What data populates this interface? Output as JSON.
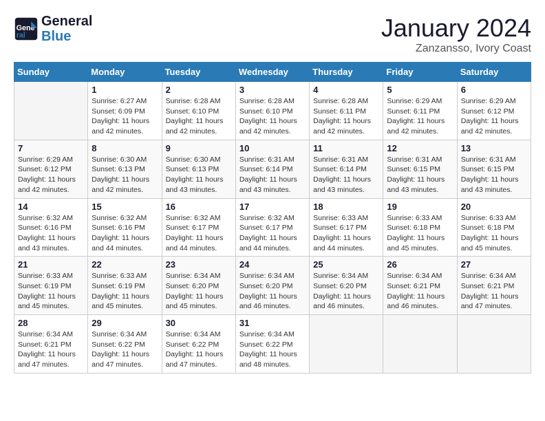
{
  "logo": {
    "line1": "General",
    "line2": "Blue"
  },
  "title": "January 2024",
  "subtitle": "Zanzansso, Ivory Coast",
  "days_header": [
    "Sunday",
    "Monday",
    "Tuesday",
    "Wednesday",
    "Thursday",
    "Friday",
    "Saturday"
  ],
  "weeks": [
    [
      {
        "day": "",
        "sunrise": "",
        "sunset": "",
        "daylight": ""
      },
      {
        "day": "1",
        "sunrise": "Sunrise: 6:27 AM",
        "sunset": "Sunset: 6:09 PM",
        "daylight": "Daylight: 11 hours and 42 minutes."
      },
      {
        "day": "2",
        "sunrise": "Sunrise: 6:28 AM",
        "sunset": "Sunset: 6:10 PM",
        "daylight": "Daylight: 11 hours and 42 minutes."
      },
      {
        "day": "3",
        "sunrise": "Sunrise: 6:28 AM",
        "sunset": "Sunset: 6:10 PM",
        "daylight": "Daylight: 11 hours and 42 minutes."
      },
      {
        "day": "4",
        "sunrise": "Sunrise: 6:28 AM",
        "sunset": "Sunset: 6:11 PM",
        "daylight": "Daylight: 11 hours and 42 minutes."
      },
      {
        "day": "5",
        "sunrise": "Sunrise: 6:29 AM",
        "sunset": "Sunset: 6:11 PM",
        "daylight": "Daylight: 11 hours and 42 minutes."
      },
      {
        "day": "6",
        "sunrise": "Sunrise: 6:29 AM",
        "sunset": "Sunset: 6:12 PM",
        "daylight": "Daylight: 11 hours and 42 minutes."
      }
    ],
    [
      {
        "day": "7",
        "sunrise": "Sunrise: 6:29 AM",
        "sunset": "Sunset: 6:12 PM",
        "daylight": "Daylight: 11 hours and 42 minutes."
      },
      {
        "day": "8",
        "sunrise": "Sunrise: 6:30 AM",
        "sunset": "Sunset: 6:13 PM",
        "daylight": "Daylight: 11 hours and 42 minutes."
      },
      {
        "day": "9",
        "sunrise": "Sunrise: 6:30 AM",
        "sunset": "Sunset: 6:13 PM",
        "daylight": "Daylight: 11 hours and 43 minutes."
      },
      {
        "day": "10",
        "sunrise": "Sunrise: 6:31 AM",
        "sunset": "Sunset: 6:14 PM",
        "daylight": "Daylight: 11 hours and 43 minutes."
      },
      {
        "day": "11",
        "sunrise": "Sunrise: 6:31 AM",
        "sunset": "Sunset: 6:14 PM",
        "daylight": "Daylight: 11 hours and 43 minutes."
      },
      {
        "day": "12",
        "sunrise": "Sunrise: 6:31 AM",
        "sunset": "Sunset: 6:15 PM",
        "daylight": "Daylight: 11 hours and 43 minutes."
      },
      {
        "day": "13",
        "sunrise": "Sunrise: 6:31 AM",
        "sunset": "Sunset: 6:15 PM",
        "daylight": "Daylight: 11 hours and 43 minutes."
      }
    ],
    [
      {
        "day": "14",
        "sunrise": "Sunrise: 6:32 AM",
        "sunset": "Sunset: 6:16 PM",
        "daylight": "Daylight: 11 hours and 43 minutes."
      },
      {
        "day": "15",
        "sunrise": "Sunrise: 6:32 AM",
        "sunset": "Sunset: 6:16 PM",
        "daylight": "Daylight: 11 hours and 44 minutes."
      },
      {
        "day": "16",
        "sunrise": "Sunrise: 6:32 AM",
        "sunset": "Sunset: 6:17 PM",
        "daylight": "Daylight: 11 hours and 44 minutes."
      },
      {
        "day": "17",
        "sunrise": "Sunrise: 6:32 AM",
        "sunset": "Sunset: 6:17 PM",
        "daylight": "Daylight: 11 hours and 44 minutes."
      },
      {
        "day": "18",
        "sunrise": "Sunrise: 6:33 AM",
        "sunset": "Sunset: 6:17 PM",
        "daylight": "Daylight: 11 hours and 44 minutes."
      },
      {
        "day": "19",
        "sunrise": "Sunrise: 6:33 AM",
        "sunset": "Sunset: 6:18 PM",
        "daylight": "Daylight: 11 hours and 45 minutes."
      },
      {
        "day": "20",
        "sunrise": "Sunrise: 6:33 AM",
        "sunset": "Sunset: 6:18 PM",
        "daylight": "Daylight: 11 hours and 45 minutes."
      }
    ],
    [
      {
        "day": "21",
        "sunrise": "Sunrise: 6:33 AM",
        "sunset": "Sunset: 6:19 PM",
        "daylight": "Daylight: 11 hours and 45 minutes."
      },
      {
        "day": "22",
        "sunrise": "Sunrise: 6:33 AM",
        "sunset": "Sunset: 6:19 PM",
        "daylight": "Daylight: 11 hours and 45 minutes."
      },
      {
        "day": "23",
        "sunrise": "Sunrise: 6:34 AM",
        "sunset": "Sunset: 6:20 PM",
        "daylight": "Daylight: 11 hours and 45 minutes."
      },
      {
        "day": "24",
        "sunrise": "Sunrise: 6:34 AM",
        "sunset": "Sunset: 6:20 PM",
        "daylight": "Daylight: 11 hours and 46 minutes."
      },
      {
        "day": "25",
        "sunrise": "Sunrise: 6:34 AM",
        "sunset": "Sunset: 6:20 PM",
        "daylight": "Daylight: 11 hours and 46 minutes."
      },
      {
        "day": "26",
        "sunrise": "Sunrise: 6:34 AM",
        "sunset": "Sunset: 6:21 PM",
        "daylight": "Daylight: 11 hours and 46 minutes."
      },
      {
        "day": "27",
        "sunrise": "Sunrise: 6:34 AM",
        "sunset": "Sunset: 6:21 PM",
        "daylight": "Daylight: 11 hours and 47 minutes."
      }
    ],
    [
      {
        "day": "28",
        "sunrise": "Sunrise: 6:34 AM",
        "sunset": "Sunset: 6:21 PM",
        "daylight": "Daylight: 11 hours and 47 minutes."
      },
      {
        "day": "29",
        "sunrise": "Sunrise: 6:34 AM",
        "sunset": "Sunset: 6:22 PM",
        "daylight": "Daylight: 11 hours and 47 minutes."
      },
      {
        "day": "30",
        "sunrise": "Sunrise: 6:34 AM",
        "sunset": "Sunset: 6:22 PM",
        "daylight": "Daylight: 11 hours and 47 minutes."
      },
      {
        "day": "31",
        "sunrise": "Sunrise: 6:34 AM",
        "sunset": "Sunset: 6:22 PM",
        "daylight": "Daylight: 11 hours and 48 minutes."
      },
      {
        "day": "",
        "sunrise": "",
        "sunset": "",
        "daylight": ""
      },
      {
        "day": "",
        "sunrise": "",
        "sunset": "",
        "daylight": ""
      },
      {
        "day": "",
        "sunrise": "",
        "sunset": "",
        "daylight": ""
      }
    ]
  ]
}
